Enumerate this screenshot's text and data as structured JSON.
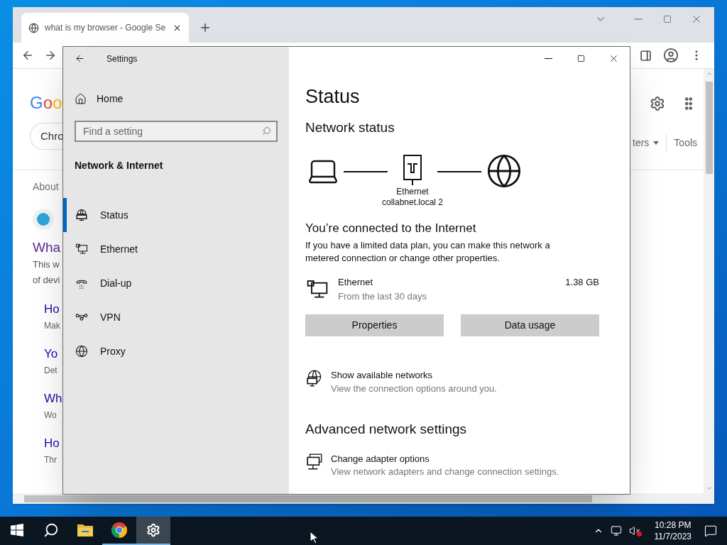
{
  "browser": {
    "tab": {
      "title": "what is my browser - Google Se",
      "selected": true
    },
    "page": {
      "logo": "Goo",
      "chip": "Chro",
      "about": "About",
      "result_title": "Wha",
      "snippet": [
        "This w",
        "of devi"
      ],
      "related": [
        {
          "title": "Ho",
          "text": "Mak"
        },
        {
          "title": "Yo",
          "text": "Det"
        },
        {
          "title": "Wh",
          "text": "Wo"
        },
        {
          "title": "Ho",
          "text": "Thr"
        }
      ],
      "filter": "ters",
      "tools": "Tools"
    }
  },
  "settings": {
    "title": "Settings",
    "home": "Home",
    "search": {
      "placeholder": "Find a setting"
    },
    "section": "Network & Internet",
    "nav": [
      {
        "label": "Status",
        "kind": "status",
        "selected": true
      },
      {
        "label": "Ethernet",
        "kind": "ethernet",
        "selected": false
      },
      {
        "label": "Dial-up",
        "kind": "dialup",
        "selected": false
      },
      {
        "label": "VPN",
        "kind": "vpn",
        "selected": false
      },
      {
        "label": "Proxy",
        "kind": "proxy",
        "selected": false
      }
    ],
    "page_title": "Status",
    "network_status": {
      "heading": "Network status",
      "adapter_label": "Ethernet",
      "network_name": "collabnet.local 2"
    },
    "connection": {
      "heading": "You’re connected to the Internet",
      "description": "If you have a limited data plan, you can make this network a metered connection or change other properties.",
      "adapter": "Ethernet",
      "usage": "1.38 GB",
      "period": "From the last 30 days"
    },
    "buttons": [
      "Properties",
      "Data usage"
    ],
    "links": [
      {
        "title": "Show available networks",
        "subtitle": "View the connection options around you.",
        "kind": "globe"
      }
    ],
    "advanced_heading": "Advanced network settings",
    "advanced_links": [
      {
        "title": "Change adapter options",
        "subtitle": "View network adapters and change connection settings.",
        "kind": "adapter"
      }
    ]
  },
  "taskbar": {
    "items": [
      {
        "kind": "start",
        "running": false,
        "selected": false
      },
      {
        "kind": "search",
        "running": false,
        "selected": false
      },
      {
        "kind": "explorer",
        "running": false,
        "selected": false
      },
      {
        "kind": "chrome",
        "running": true,
        "selected": false
      },
      {
        "kind": "settings",
        "running": true,
        "selected": true
      }
    ],
    "time": "10:28 PM",
    "date": "11/7/2023"
  }
}
